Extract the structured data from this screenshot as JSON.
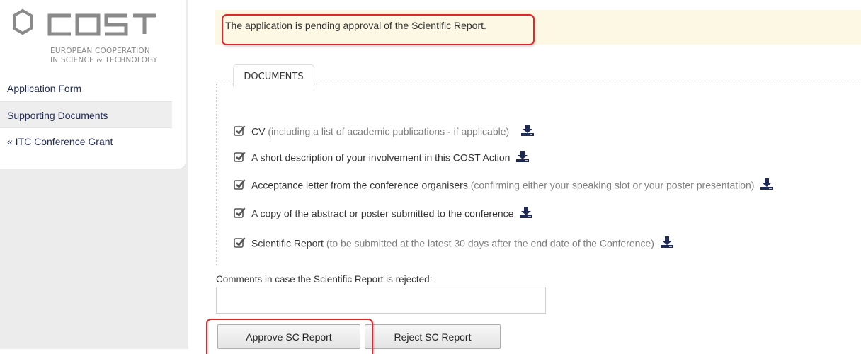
{
  "brand": {
    "logo_text": "cost",
    "tagline_line1": "EUROPEAN COOPERATION",
    "tagline_line2": "IN SCIENCE & TECHNOLOGY"
  },
  "sidebar": {
    "items": [
      {
        "label": "Application Form"
      },
      {
        "label": "Supporting Documents"
      },
      {
        "label": "« ITC Conference Grant"
      }
    ]
  },
  "status": {
    "message": "The application is pending approval of the Scientific Report."
  },
  "documents": {
    "tab_label": "DOCUMENTS",
    "items": [
      {
        "title": "CV",
        "note": " (including a list of academic publications - if applicable)",
        "checked": true
      },
      {
        "title": "A short description of your involvement in this COST Action",
        "note": "",
        "checked": true
      },
      {
        "title": "Acceptance letter from the conference organisers",
        "note": " (confirming either your speaking slot or your poster presentation)",
        "checked": true
      },
      {
        "title": "A copy of the abstract or poster submitted to the conference",
        "note": "",
        "checked": true
      },
      {
        "title": "Scientific Report",
        "note": " (to be submitted at the latest 30 days after the end date of the Conference)",
        "checked": true
      }
    ]
  },
  "comments": {
    "label": "Comments in case the Scientific Report is rejected:",
    "value": ""
  },
  "actions": {
    "approve_label": "Approve SC Report",
    "reject_label": "Reject SC Report"
  },
  "colors": {
    "highlight": "#e2262a",
    "banner_bg": "#fcf8e3",
    "nav_text": "#1f2a55",
    "icon": "#1f2a55"
  }
}
